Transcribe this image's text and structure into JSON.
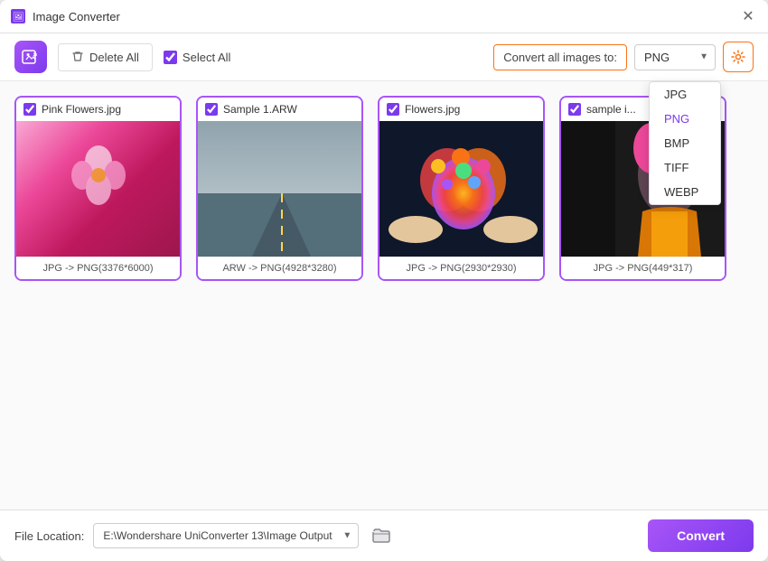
{
  "window": {
    "title": "Image Converter"
  },
  "toolbar": {
    "delete_all_label": "Delete All",
    "select_all_label": "Select All",
    "convert_label": "Convert all images to:",
    "selected_format": "PNG",
    "format_options": [
      "JPG",
      "PNG",
      "BMP",
      "TIFF",
      "WEBP"
    ]
  },
  "dropdown": {
    "visible": true,
    "items": [
      "JPG",
      "PNG",
      "BMP",
      "TIFF",
      "WEBP"
    ],
    "selected": "PNG"
  },
  "images": [
    {
      "filename": "Pink Flowers.jpg",
      "conversion": "JPG -> PNG(3376*6000)",
      "img_class": "img-pink-flowers",
      "checked": true
    },
    {
      "filename": "Sample 1.ARW",
      "conversion": "ARW -> PNG(4928*3280)",
      "img_class": "img-sample-arw",
      "checked": true
    },
    {
      "filename": "Flowers.jpg",
      "conversion": "JPG -> PNG(2930*2930)",
      "img_class": "img-flowers-jpg",
      "checked": true
    },
    {
      "filename": "sample i...",
      "conversion": "JPG -> PNG(449*317)",
      "img_class": "img-sample-i",
      "checked": true
    }
  ],
  "status_bar": {
    "file_location_label": "File Location:",
    "file_location_value": "E:\\Wondershare UniConverter 13\\Image Output",
    "convert_button_label": "Convert"
  }
}
